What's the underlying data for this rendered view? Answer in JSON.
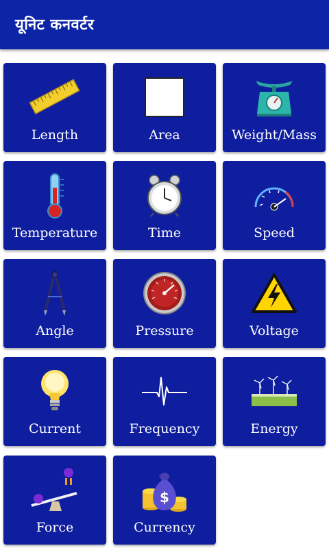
{
  "appbar": {
    "title": "यूनिट कनवर्टर"
  },
  "tiles": [
    {
      "label": "Length",
      "icon": "ruler-icon"
    },
    {
      "label": "Area",
      "icon": "square-icon"
    },
    {
      "label": "Weight/Mass",
      "icon": "weighing-scale-icon"
    },
    {
      "label": "Temperature",
      "icon": "thermometer-icon"
    },
    {
      "label": "Time",
      "icon": "alarm-clock-icon"
    },
    {
      "label": "Speed",
      "icon": "speedometer-icon"
    },
    {
      "label": "Angle",
      "icon": "compass-icon"
    },
    {
      "label": "Pressure",
      "icon": "pressure-gauge-icon"
    },
    {
      "label": "Voltage",
      "icon": "high-voltage-icon"
    },
    {
      "label": "Current",
      "icon": "light-bulb-icon"
    },
    {
      "label": "Frequency",
      "icon": "heartbeat-wave-icon"
    },
    {
      "label": "Energy",
      "icon": "wind-turbine-icon"
    },
    {
      "label": "Force",
      "icon": "seesaw-icon"
    },
    {
      "label": "Currency",
      "icon": "money-bag-icon"
    }
  ],
  "colors": {
    "appbar": "#0d24a6",
    "tile": "#0f1e9e",
    "text": "#ffffff"
  }
}
